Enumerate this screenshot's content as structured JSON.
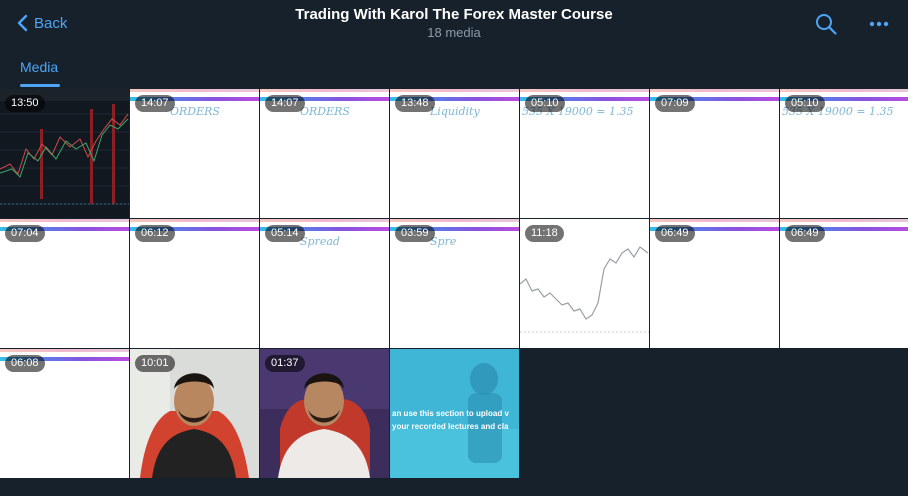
{
  "header": {
    "back_label": "Back",
    "title": "Trading With Karol The Forex Master Course",
    "subtitle": "18 media"
  },
  "tabs": [
    {
      "label": "Media",
      "active": true
    }
  ],
  "icons": {
    "back": "chevron-left-icon",
    "search": "search-icon",
    "more": "more-horizontal-icon"
  },
  "colors": {
    "background": "#17212b",
    "accent": "#4ea4f6",
    "muted_text": "#8d9ba8"
  },
  "media": [
    {
      "duration": "13:50",
      "kind": "chart-dark"
    },
    {
      "duration": "14:07",
      "kind": "whiteboard",
      "handwriting": "ORDERS"
    },
    {
      "duration": "14:07",
      "kind": "whiteboard",
      "handwriting": "ORDERS"
    },
    {
      "duration": "13:48",
      "kind": "whiteboard",
      "handwriting": "Liquidity"
    },
    {
      "duration": "05:10",
      "kind": "whiteboard",
      "handwriting": "535 X 19000 = 1.35"
    },
    {
      "duration": "07:09",
      "kind": "whiteboard",
      "handwriting": ""
    },
    {
      "duration": "05:10",
      "kind": "whiteboard",
      "handwriting": "535 X 19000 = 1.35"
    },
    {
      "duration": "07:04",
      "kind": "whiteboard",
      "handwriting": ""
    },
    {
      "duration": "06:12",
      "kind": "whiteboard",
      "handwriting": ""
    },
    {
      "duration": "05:14",
      "kind": "whiteboard",
      "handwriting": "Spread"
    },
    {
      "duration": "03:59",
      "kind": "whiteboard",
      "handwriting": "Spre"
    },
    {
      "duration": "11:18",
      "kind": "chart-light"
    },
    {
      "duration": "06:49",
      "kind": "whiteboard",
      "handwriting": ""
    },
    {
      "duration": "06:49",
      "kind": "whiteboard",
      "handwriting": ""
    },
    {
      "duration": "06:08",
      "kind": "whiteboard",
      "handwriting": ""
    },
    {
      "duration": "10:01",
      "kind": "presenter-dark"
    },
    {
      "duration": "01:37",
      "kind": "presenter-light"
    },
    {
      "duration": "",
      "kind": "promo",
      "text": "an use this section to upload v your recorded lectures and cla"
    }
  ]
}
